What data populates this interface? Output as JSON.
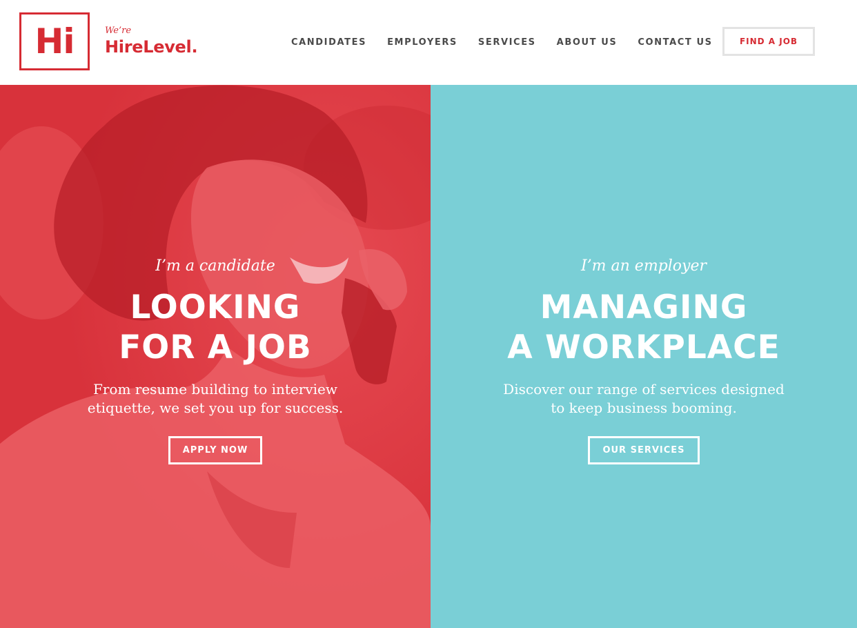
{
  "brand": {
    "logo_mark": "Hi",
    "tagline": "We’re",
    "name": "HireLevel.",
    "color": "#d62b33"
  },
  "nav": {
    "items": [
      {
        "label": "CANDIDATES"
      },
      {
        "label": "EMPLOYERS"
      },
      {
        "label": "SERVICES"
      },
      {
        "label": "ABOUT US"
      },
      {
        "label": "CONTACT US"
      }
    ],
    "cta_label": "FIND A JOB"
  },
  "candidate": {
    "eyebrow": "I’m a candidate",
    "headline_line1": "LOOKING",
    "headline_line2": "FOR A JOB",
    "desc_line1": "From resume building to interview",
    "desc_line2": "etiquette, we set you up for success.",
    "cta_label": "APPLY NOW",
    "background_color": "#e03e47"
  },
  "employer": {
    "eyebrow": "I’m an employer",
    "headline_line1": "MANAGING",
    "headline_line2": "A WORKPLACE",
    "desc_line1": "Discover our range of services designed",
    "desc_line2": "to keep business booming.",
    "cta_label": "OUR SERVICES",
    "background_color": "#7acfd6"
  }
}
